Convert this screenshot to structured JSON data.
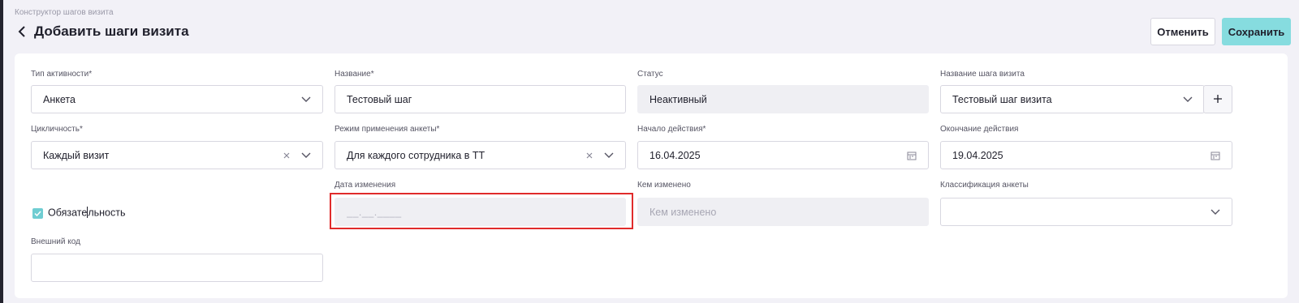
{
  "breadcrumb": "Конструктор шагов визита",
  "page_title": "Добавить шаги визита",
  "buttons": {
    "cancel": "Отменить",
    "save": "Сохранить"
  },
  "fields": {
    "activity_type": {
      "label": "Тип активности*",
      "value": "Анкета"
    },
    "name": {
      "label": "Название*",
      "value": "Тестовый шаг"
    },
    "status": {
      "label": "Статус",
      "value": "Неактивный"
    },
    "step_name": {
      "label": "Название шага визита",
      "value": "Тестовый шаг визита"
    },
    "cyclicity": {
      "label": "Цикличность*",
      "value": "Каждый визит"
    },
    "survey_mode": {
      "label": "Режим применения анкеты*",
      "value": "Для каждого сотрудника в ТТ"
    },
    "start_date": {
      "label": "Начало действия*",
      "value": "16.04.2025"
    },
    "end_date": {
      "label": "Окончание действия",
      "value": "19.04.2025"
    },
    "changed_date": {
      "label": "Дата изменения",
      "value": "__.__.____"
    },
    "changed_by": {
      "label": "Кем изменено",
      "placeholder": "Кем изменено"
    },
    "survey_classification": {
      "label": "Классификация анкеты",
      "value": ""
    },
    "external_code": {
      "label": "Внешний код",
      "value": ""
    }
  },
  "mandatory": {
    "label_before_cursor": "Обязате",
    "label_after_cursor": "льность",
    "checked": true
  },
  "colors": {
    "accent": "#86dcdf",
    "checkbox": "#6fcdd2",
    "highlight": "#e02b2b"
  }
}
